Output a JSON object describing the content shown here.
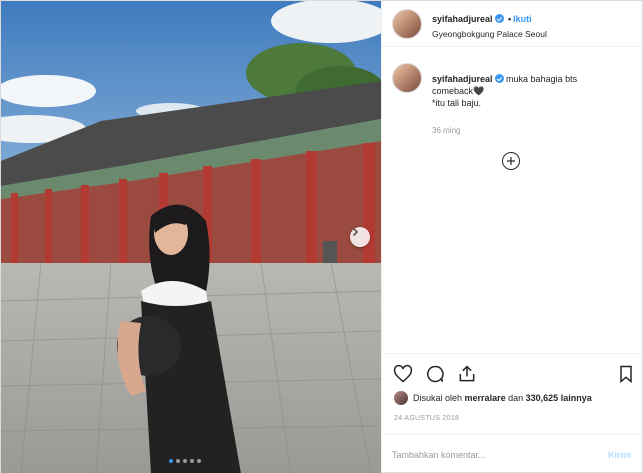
{
  "post": {
    "username": "syifahadjureal",
    "follow_separator": "•",
    "follow_label": "Ikuti",
    "location": "Gyeongbokgung Palace Seoul",
    "caption": {
      "username": "syifahadjureal",
      "line1": "muka bahagia bts",
      "line2": "comeback🖤",
      "line3": "*itu tali baju."
    },
    "time_ago": "36 ming",
    "load_more_icon": "plus-circle-icon",
    "likes": {
      "prefix": "Disukai oleh",
      "user": "merralare",
      "joiner": "dan",
      "count": "330,625 lainnya"
    },
    "date": "24 AGUSTUS 2018",
    "comment_placeholder": "Tambahkan komentar...",
    "send_label": "Kirim",
    "carousel": {
      "total": 5,
      "active": 0
    }
  },
  "colors": {
    "accent": "#3897f0",
    "send_disabled": "#b2dffc",
    "muted": "#999999"
  }
}
